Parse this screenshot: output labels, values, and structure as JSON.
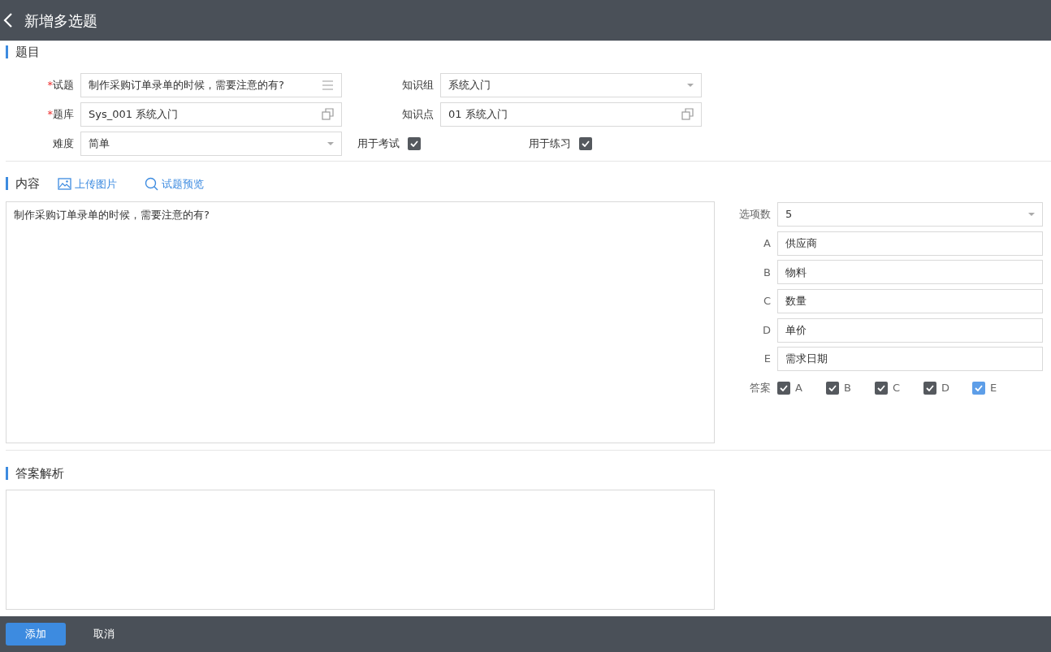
{
  "header": {
    "title": "新增多选题"
  },
  "question_section": {
    "title": "题目",
    "left_fields": [
      {
        "label": "试题",
        "required_mark": "*",
        "kind": "memo",
        "value": "制作采购订单录单的时候，需要注意的有?"
      },
      {
        "label": "题库",
        "required_mark": "*",
        "kind": "lookup",
        "value": "Sys_001 系统入门"
      },
      {
        "label": "难度",
        "kind": "select",
        "value": "简单"
      }
    ],
    "right_fields": [
      {
        "label": "知识组",
        "kind": "select",
        "value": "系统入门"
      },
      {
        "label": "知识点",
        "kind": "lookup",
        "value": "01 系统入门"
      }
    ],
    "flags": [
      {
        "label": "用于考试",
        "checked": true
      },
      {
        "label": "用于练习",
        "checked": true
      }
    ]
  },
  "content_section": {
    "title": "内容",
    "actions": [
      {
        "label": "上传图片",
        "kind": "image"
      },
      {
        "label": "试题预览",
        "kind": "search"
      }
    ],
    "text": "制作采购订单录单的时候，需要注意的有?",
    "option_count": {
      "label": "选项数",
      "value": "5"
    },
    "options": [
      {
        "letter": "A",
        "value": "供应商"
      },
      {
        "letter": "B",
        "value": "物料"
      },
      {
        "letter": "C",
        "value": "数量"
      },
      {
        "letter": "D",
        "value": "单价"
      },
      {
        "letter": "E",
        "value": "需求日期"
      }
    ],
    "answer_label": "答案",
    "answers": [
      {
        "letter": "A",
        "checked": true,
        "focused": false
      },
      {
        "letter": "B",
        "checked": true,
        "focused": false
      },
      {
        "letter": "C",
        "checked": true,
        "focused": false
      },
      {
        "letter": "D",
        "checked": true,
        "focused": false
      },
      {
        "letter": "E",
        "checked": true,
        "focused": true
      }
    ]
  },
  "analysis_section": {
    "title": "答案解析"
  },
  "footer": {
    "buttons": [
      {
        "label": "添加",
        "primary": true
      },
      {
        "label": "取消",
        "primary": false
      }
    ]
  }
}
